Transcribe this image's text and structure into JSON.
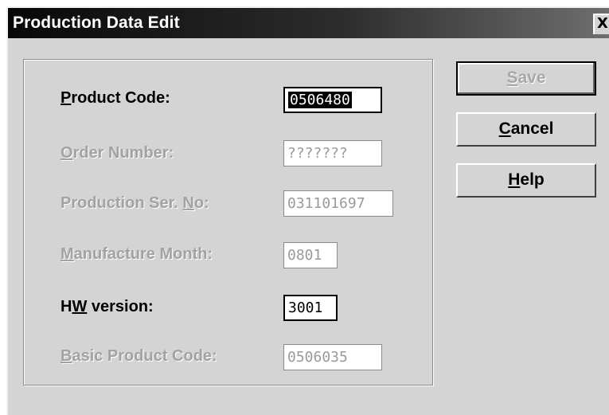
{
  "window": {
    "title": "Production Data Edit",
    "close_label": "X"
  },
  "form": {
    "product_code": {
      "label_accel": "P",
      "label_rest": "roduct Code:",
      "value": "0506480"
    },
    "order_number": {
      "label_accel": "O",
      "label_rest": "rder Number:",
      "value": "???????"
    },
    "production_ser_no": {
      "label_pre": "Production Ser. ",
      "label_accel": "N",
      "label_post": "o:",
      "value": "031101697"
    },
    "manufacture_month": {
      "label_accel": "M",
      "label_rest": "anufacture Month:",
      "value": "0801"
    },
    "hw_version": {
      "label_pre": "H",
      "label_accel": "W",
      "label_post": " version:",
      "value": "3001"
    },
    "basic_product_code": {
      "label_accel": "B",
      "label_rest": "asic Product Code:",
      "value": "0506035"
    }
  },
  "buttons": {
    "save": {
      "accel": "S",
      "rest": "ave"
    },
    "cancel": {
      "accel": "C",
      "rest": "ancel"
    },
    "help": {
      "accel": "H",
      "rest": "elp"
    }
  }
}
